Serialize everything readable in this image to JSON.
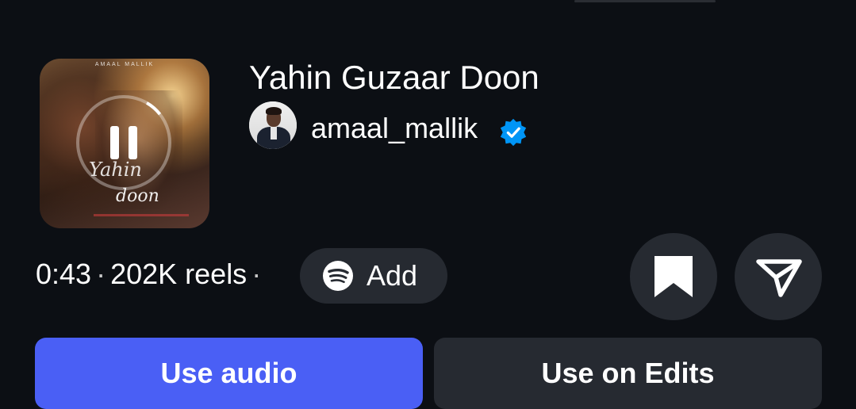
{
  "track": {
    "title": "Yahin Guzaar Doon",
    "cover_artist_text": "AMAAL MALLIK",
    "cover_title_line1": "Yahin",
    "cover_title_line2": "doon",
    "playback_state": "playing"
  },
  "artist": {
    "username": "amaal_mallik",
    "verified": true
  },
  "meta": {
    "duration": "0:43",
    "separator": "·",
    "reels_count": "202K reels"
  },
  "spotify": {
    "add_label": "Add",
    "icon": "spotify-icon"
  },
  "actions": {
    "save_icon": "bookmark-icon",
    "share_icon": "send-icon",
    "use_audio_label": "Use audio",
    "use_edits_label": "Use on Edits"
  },
  "colors": {
    "background": "#0c0f14",
    "primary_button": "#4a5ff5",
    "secondary_button": "#262a31",
    "verified_badge": "#0095f6"
  }
}
